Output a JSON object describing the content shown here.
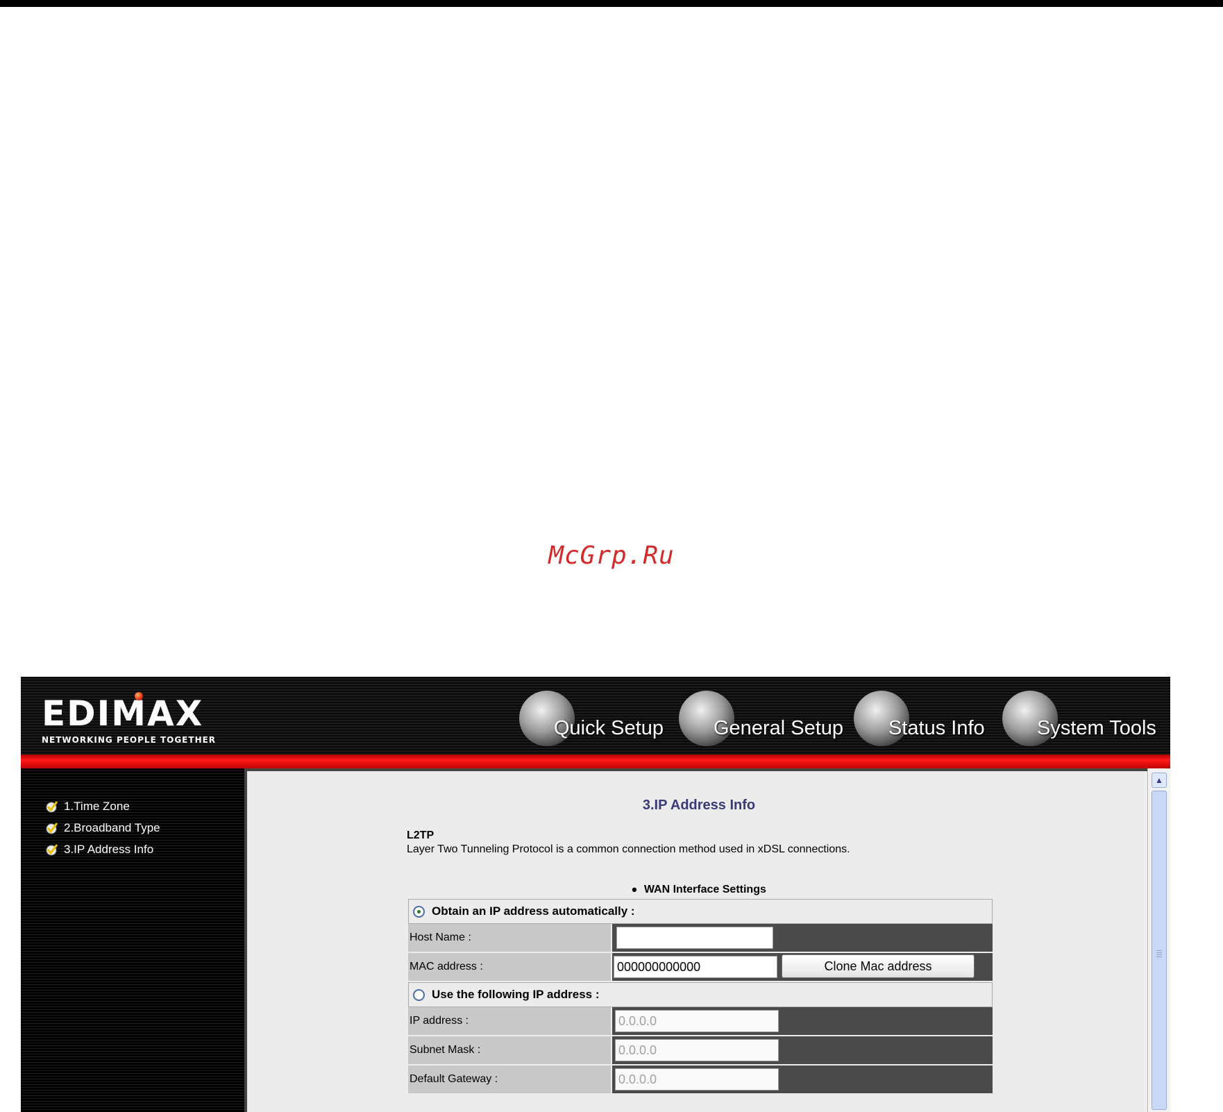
{
  "watermark": "McGrp.Ru",
  "logo": {
    "name": "EDIMAX",
    "tagline": "NETWORKING PEOPLE TOGETHER"
  },
  "nav": [
    {
      "label": "Quick Setup"
    },
    {
      "label": "General Setup"
    },
    {
      "label": "Status Info"
    },
    {
      "label": "System Tools"
    }
  ],
  "sidebar": {
    "items": [
      {
        "label": "1.Time Zone",
        "icon": "check-icon"
      },
      {
        "label": "2.Broadband Type",
        "icon": "check-icon"
      },
      {
        "label": "3.IP Address Info",
        "icon": "check-icon"
      }
    ]
  },
  "main": {
    "title": "3.IP Address Info",
    "protocol": "L2TP",
    "description": "Layer Two Tunneling Protocol is a common connection method used in xDSL connections.",
    "section_title": "WAN Interface Settings",
    "auto": {
      "label": "Obtain an IP address automatically :",
      "selected": true,
      "host_name_label": "Host Name :",
      "host_name_value": "",
      "mac_label": "MAC address :",
      "mac_value": "000000000000",
      "clone_button": "Clone Mac address"
    },
    "static": {
      "label": "Use the following IP address :",
      "selected": false,
      "ip_label": "IP address :",
      "ip_value": "0.0.0.0",
      "subnet_label": "Subnet Mask :",
      "subnet_value": "0.0.0.0",
      "gateway_label": "Default Gateway :",
      "gateway_value": "0.0.0.0"
    }
  },
  "colors": {
    "accent_red": "#e01010",
    "title_blue": "#3a3a7a",
    "watermark_red": "#d42a2a"
  }
}
